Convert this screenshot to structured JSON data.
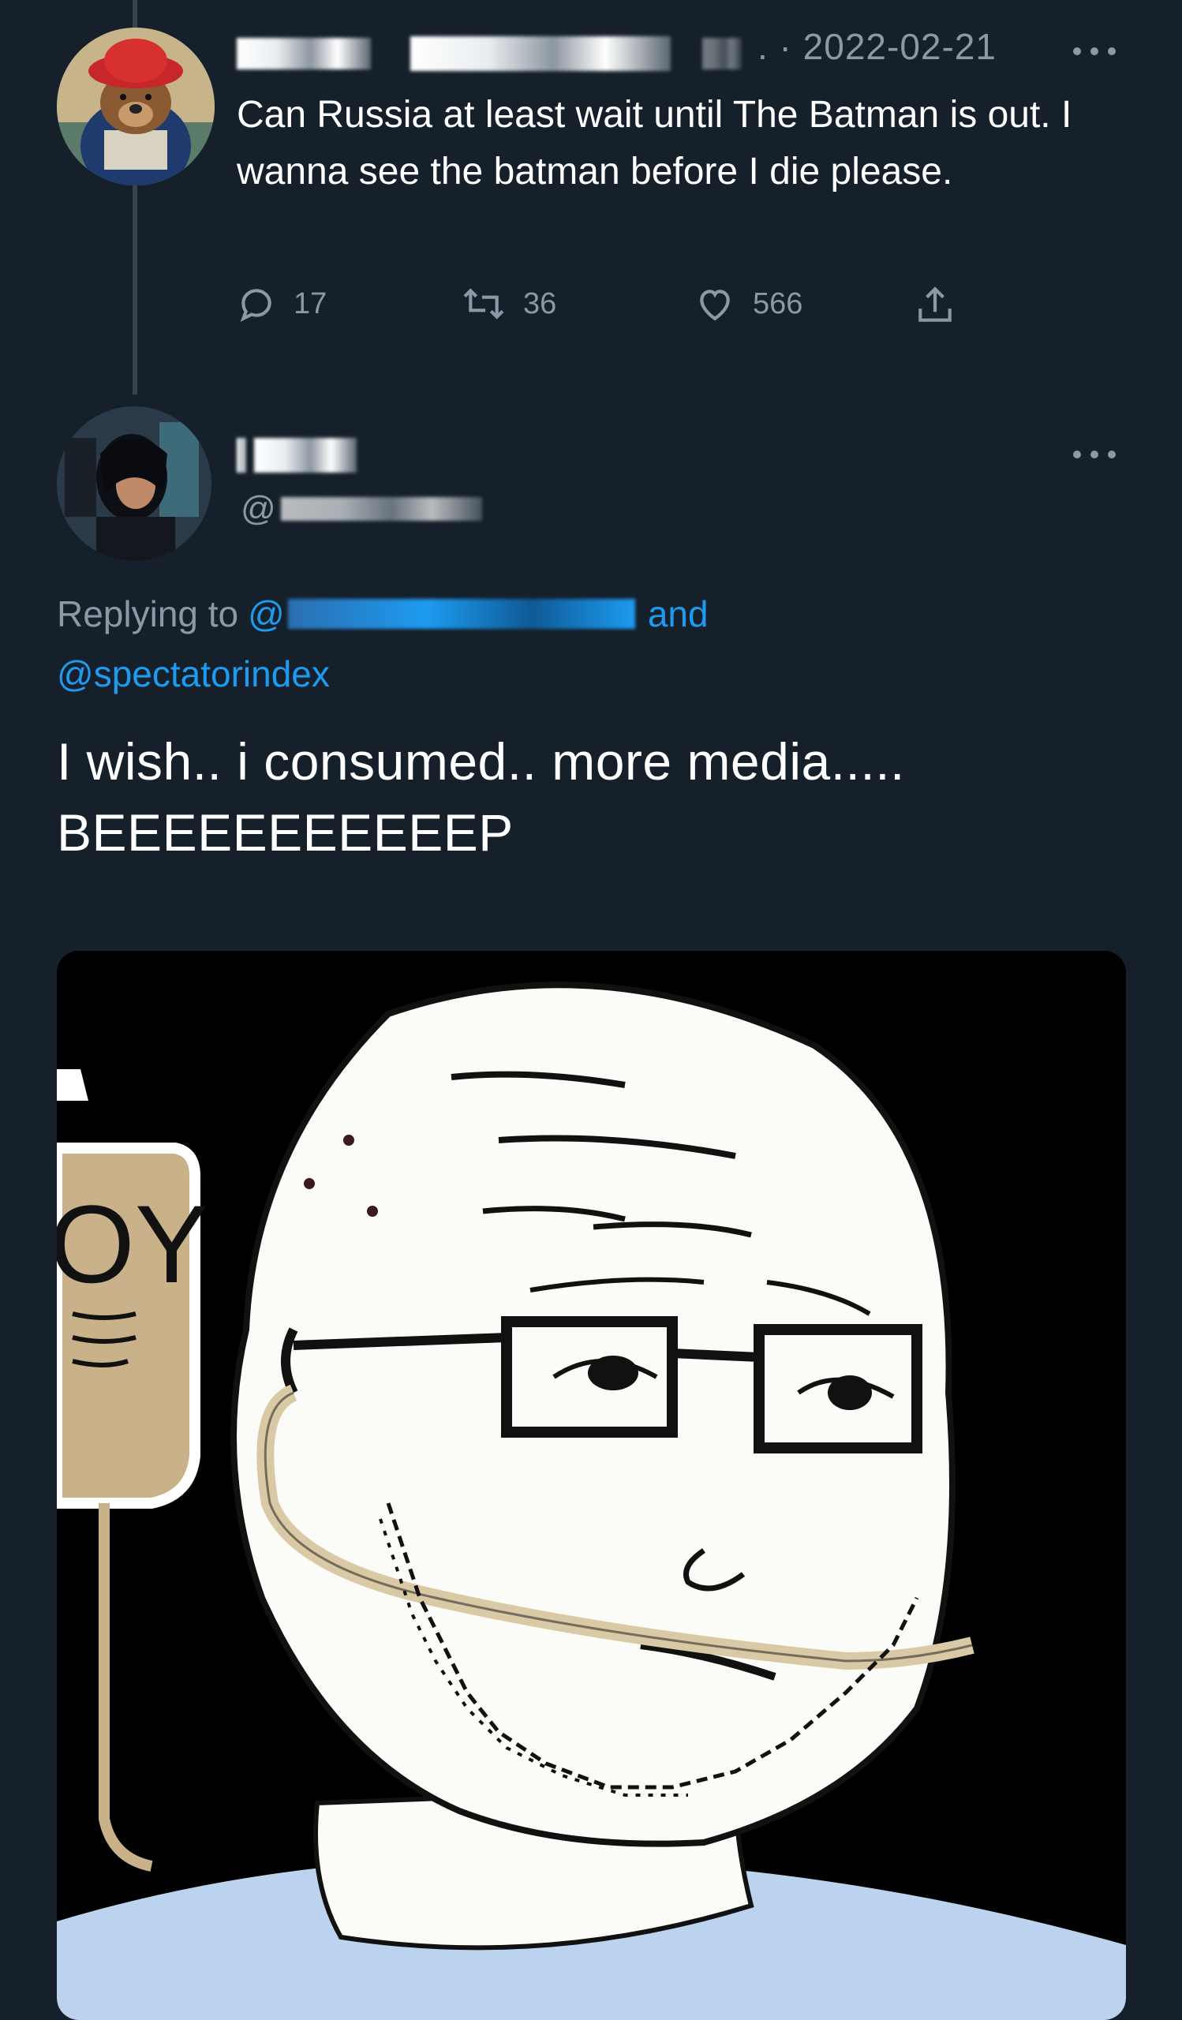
{
  "parent_tweet": {
    "timestamp": "2022-02-21",
    "timestamp_prefix": ". · ",
    "text": "Can Russia at least wait until The Batman is out. I wanna see the batman before I die please.",
    "reply_count": "17",
    "retweet_count": "36",
    "like_count": "566"
  },
  "reply_tweet": {
    "handle_prefix": "@",
    "replying_to_label": "Replying to",
    "replying_at": "@",
    "replying_and": "and",
    "replying_second": "@spectatorindex",
    "text_line_1": "I wish.. i consumed.. more media.....",
    "text_line_2": "BEEEEEEEEEEEP",
    "media_label": "OY"
  },
  "colors": {
    "background": "#15202b",
    "text_primary": "#ffffff",
    "text_secondary": "#8b98a5",
    "link": "#1d9bf0",
    "thread_line": "#38444d"
  },
  "icons": {
    "reply": "reply-icon",
    "retweet": "retweet-icon",
    "like": "heart-icon",
    "share": "share-icon",
    "more": "more-icon"
  }
}
